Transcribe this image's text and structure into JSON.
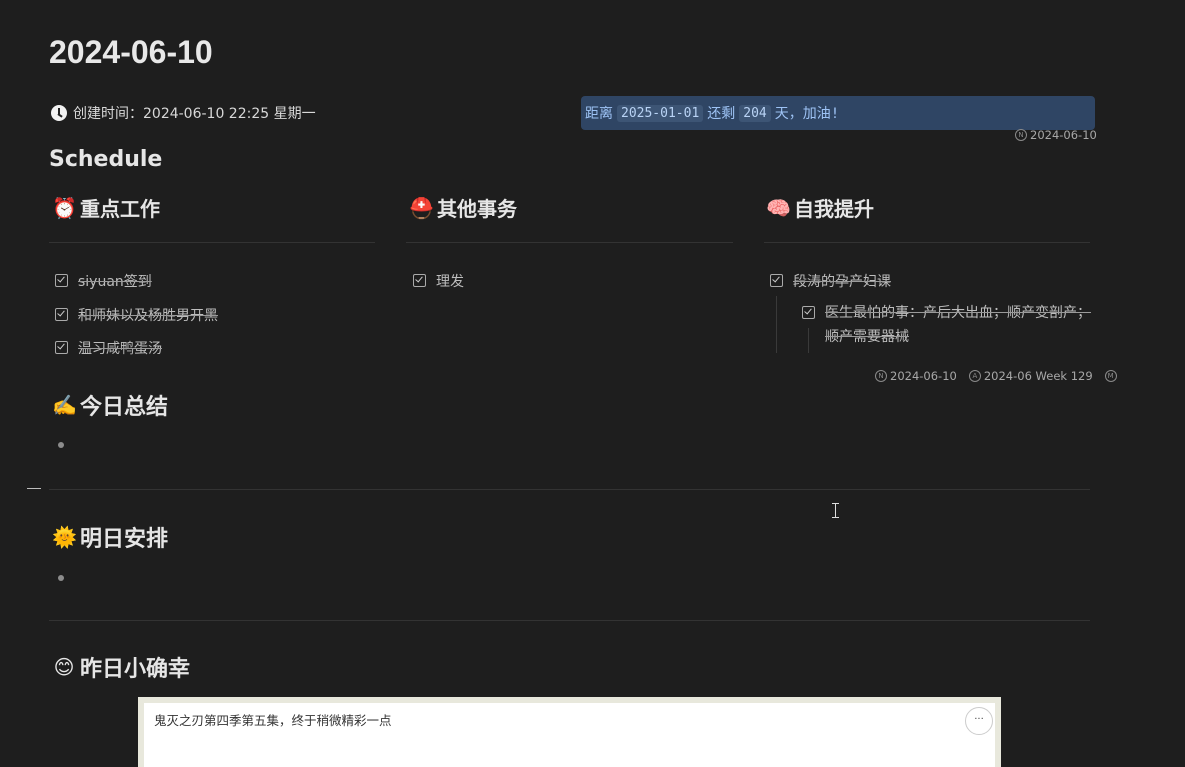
{
  "doc": {
    "title": "2024-06-10",
    "created_label": "创建时间：2024-06-10 22:25 星期一",
    "countdown": {
      "prefix": "距离",
      "date": "2025-01-01",
      "middle": "还剩",
      "days": "204",
      "suffix": "天，加油!"
    },
    "countdown_meta": "2024-06-10"
  },
  "schedule": {
    "heading": "Schedule",
    "columns": [
      {
        "emoji": "⏰",
        "title": "重点工作",
        "tasks": [
          "siyuan签到",
          "和师妹以及杨胜男开黑",
          "温习咸鸭蛋汤"
        ]
      },
      {
        "emoji": "⛑️",
        "title": "其他事务",
        "tasks": [
          "理发"
        ]
      },
      {
        "emoji": "🧠",
        "title": "自我提升",
        "tasks": [
          "段涛的孕产妇课"
        ],
        "subtasks": [
          "医生最怕的事：产后大出血；顺产变剖产；顺产需要器械"
        ]
      }
    ],
    "meta": {
      "created": "2024-06-10",
      "tag": "2024-06 Week 129"
    }
  },
  "sections": {
    "summary": {
      "emoji": "✍️",
      "title": "今日总结"
    },
    "tomorrow": {
      "emoji": "🌞",
      "title": "明日安排"
    },
    "happiness": {
      "emoji": "😊",
      "title": "昨日小确幸"
    }
  },
  "card": {
    "text": "鬼灭之刃第四季第五集，终于稍微精彩一点",
    "more_label": "···"
  }
}
